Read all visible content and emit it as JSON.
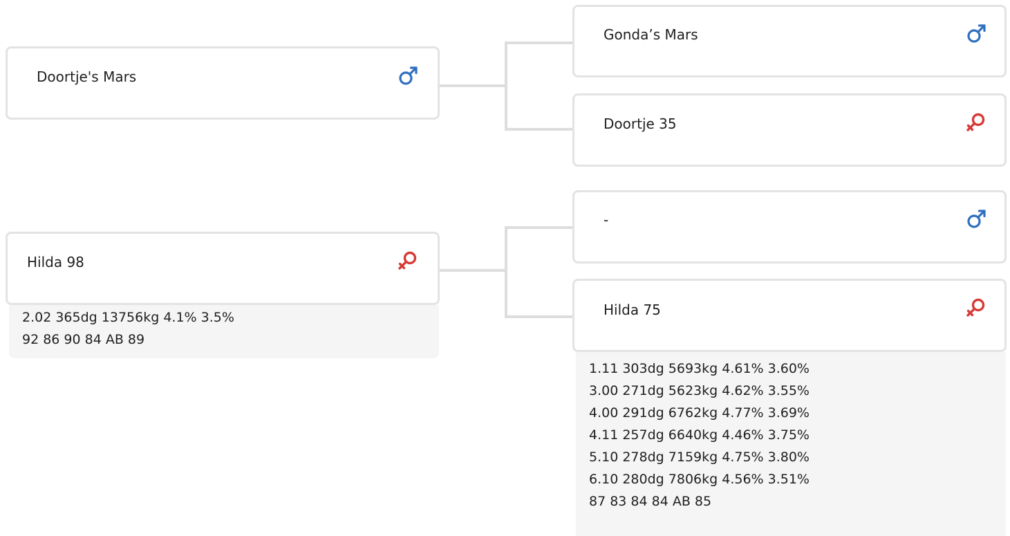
{
  "colors": {
    "male": "#2f6fbf",
    "female": "#d63a36",
    "card_border": "#e3e3e3",
    "connector": "#dddddd",
    "stats_background": "#f5f5f5"
  },
  "parents": {
    "sire": {
      "name": "Doortje's Mars",
      "sex": "male",
      "sex_icon": "male-icon"
    },
    "dam": {
      "name": "Hilda 98",
      "sex": "female",
      "sex_icon": "female-icon",
      "stats": [
        "2.02 365dg 13756kg 4.1% 3.5%",
        "92 86 90 84 AB 89"
      ]
    }
  },
  "grandparents": {
    "sire_sire": {
      "name": "Gonda’s Mars",
      "sex": "male",
      "sex_icon": "male-icon"
    },
    "sire_dam": {
      "name": "Doortje 35",
      "sex": "female",
      "sex_icon": "female-icon"
    },
    "dam_sire": {
      "name": "-",
      "sex": "male",
      "sex_icon": "male-icon"
    },
    "dam_dam": {
      "name": "Hilda 75",
      "sex": "female",
      "sex_icon": "female-icon",
      "stats": [
        "1.11 303dg 5693kg 4.61% 3.60%",
        "3.00 271dg 5623kg 4.62% 3.55%",
        "4.00 291dg 6762kg 4.77% 3.69%",
        "4.11 257dg 6640kg 4.46% 3.75%",
        "5.10 278dg 7159kg 4.75% 3.80%",
        "6.10 280dg 7806kg 4.56% 3.51%",
        "87 83 84 84 AB 85"
      ]
    }
  }
}
